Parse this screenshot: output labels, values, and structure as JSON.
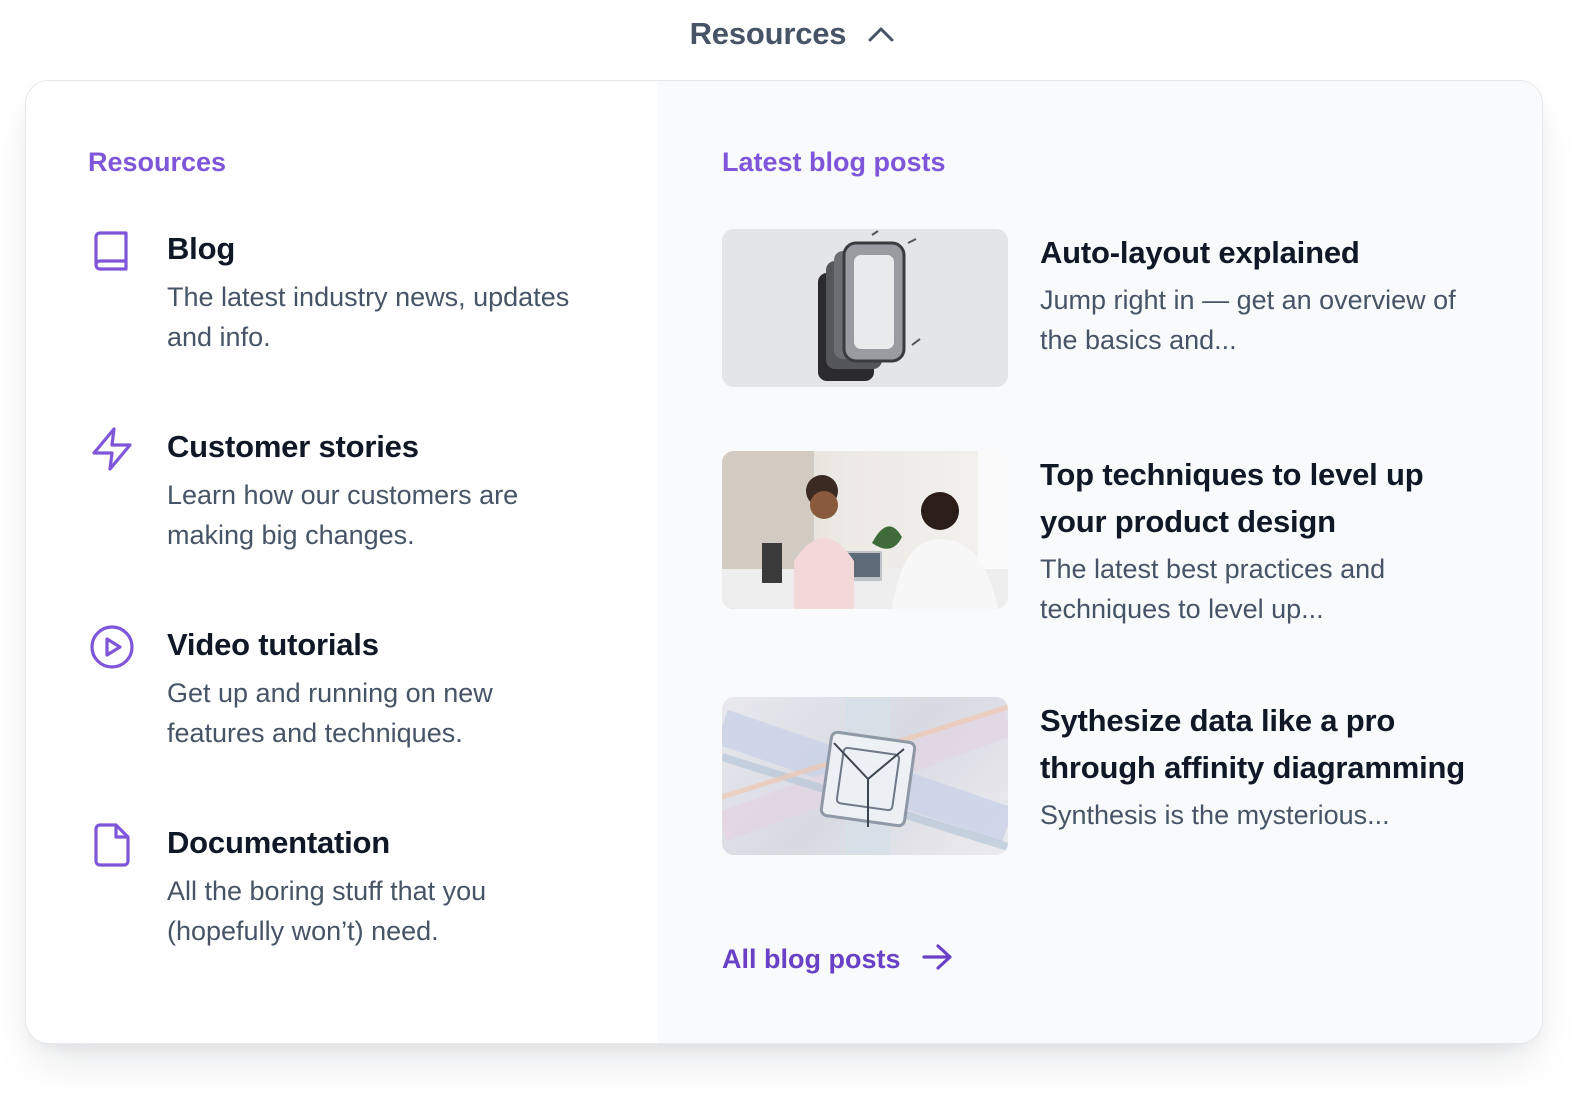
{
  "trigger": {
    "label": "Resources",
    "icon": "chevron-up-icon"
  },
  "left": {
    "title": "Resources",
    "items": [
      {
        "icon": "book-icon",
        "title": "Blog",
        "desc": "The latest industry news, updates and info."
      },
      {
        "icon": "lightning-icon",
        "title": "Customer stories",
        "desc": "Learn how our customers are making big changes."
      },
      {
        "icon": "play-circle-icon",
        "title": "Video tutorials",
        "desc": "Get up and running on new features and techniques."
      },
      {
        "icon": "file-icon",
        "title": "Documentation",
        "desc": "All the boring stuff that you (hopefully won’t) need."
      }
    ]
  },
  "right": {
    "title": "Latest blog posts",
    "posts": [
      {
        "title": "Auto-layout explained",
        "desc": "Jump right in — get an overview of the basics and..."
      },
      {
        "title": "Top techniques to level up your product design",
        "desc": "The latest best practices and techniques to level up..."
      },
      {
        "title": "Sythesize data like a pro through affinity diagramming",
        "desc": "Synthesis is the mysterious..."
      }
    ],
    "all_link": {
      "label": "All blog posts",
      "icon": "arrow-right-icon"
    }
  },
  "colors": {
    "accent": "#7f56d9",
    "link": "#6941c6",
    "heading": "#101828",
    "muted": "#475467"
  }
}
